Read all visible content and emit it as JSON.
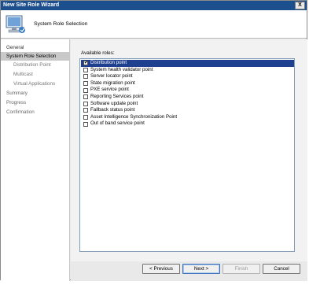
{
  "window": {
    "title": "New Site Role Wizard",
    "close_symbol": "X"
  },
  "header": {
    "title": "System Role Selection",
    "icon": "computer-wizard-icon"
  },
  "nav": {
    "items": [
      {
        "label": "General"
      },
      {
        "label": "System Role Selection"
      },
      {
        "label": "Distribution Point"
      },
      {
        "label": "Multicast"
      },
      {
        "label": "Virtual Applications"
      },
      {
        "label": "Summary"
      },
      {
        "label": "Progress"
      },
      {
        "label": "Confirmation"
      }
    ]
  },
  "roles": {
    "label": "Available roles:",
    "items": [
      {
        "label": "Distribution point",
        "checked": true,
        "selected": true
      },
      {
        "label": "System health validator point",
        "checked": false
      },
      {
        "label": "Server locator point",
        "checked": false
      },
      {
        "label": "State migration point",
        "checked": false
      },
      {
        "label": "PXE service point",
        "checked": false
      },
      {
        "label": "Reporting Services point",
        "checked": false
      },
      {
        "label": "Software update point",
        "checked": false
      },
      {
        "label": "Fallback status point",
        "checked": false
      },
      {
        "label": "Asset Intelligence Synchronization Point",
        "checked": false
      },
      {
        "label": "Out of band service point",
        "checked": false
      }
    ]
  },
  "buttons": {
    "previous": "< Previous",
    "next": "Next >",
    "finish": "Finish",
    "cancel": "Cancel"
  },
  "colors": {
    "titlebar": "#1c4f8e",
    "selection": "#1f3f8f"
  }
}
